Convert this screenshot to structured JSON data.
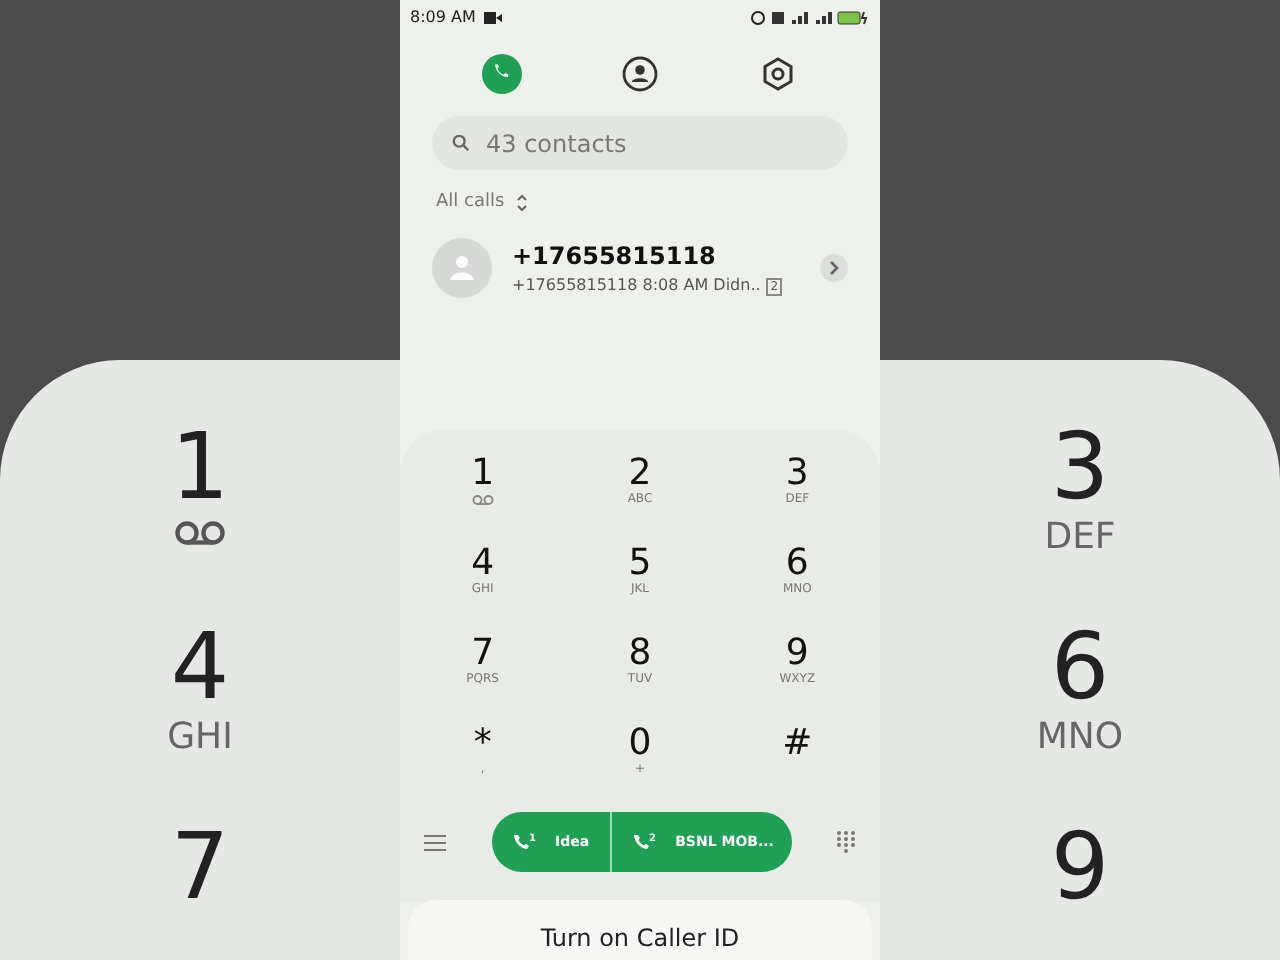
{
  "backdrop_left": [
    {
      "digit": "1",
      "kind": "voicemail"
    },
    {
      "digit": "4",
      "letters": "GHI"
    },
    {
      "digit": "7"
    }
  ],
  "backdrop_right": [
    {
      "digit": "3",
      "letters": "DEF"
    },
    {
      "digit": "6",
      "letters": "MNO"
    },
    {
      "digit": "9"
    }
  ],
  "status_bar": {
    "time": "8:09 AM"
  },
  "tabs": [
    {
      "kind": "phone",
      "selected": true
    },
    {
      "kind": "contacts",
      "selected": false
    },
    {
      "kind": "settings",
      "selected": false
    }
  ],
  "search": {
    "placeholder": "43 contacts"
  },
  "filter": {
    "label": "All calls"
  },
  "calls": [
    {
      "name": "+17655815118",
      "detail": "+17655815118  8:08 AM Didn..",
      "sim": "2"
    }
  ],
  "keys": [
    {
      "digit": "1",
      "kind": "voicemail"
    },
    {
      "digit": "2",
      "letters": "ABC"
    },
    {
      "digit": "3",
      "letters": "DEF"
    },
    {
      "digit": "4",
      "letters": "GHI"
    },
    {
      "digit": "5",
      "letters": "JKL"
    },
    {
      "digit": "6",
      "letters": "MNO"
    },
    {
      "digit": "7",
      "letters": "PQRS"
    },
    {
      "digit": "8",
      "letters": "TUV"
    },
    {
      "digit": "9",
      "letters": "WXYZ"
    },
    {
      "digit": "*",
      "letters": ","
    },
    {
      "digit": "0",
      "letters": "+"
    },
    {
      "digit": "#"
    }
  ],
  "sim_buttons": [
    {
      "label": "Idea",
      "sim": "1"
    },
    {
      "label": "BSNL MOB...",
      "sim": "2"
    }
  ],
  "sheet": {
    "title": "Turn on Caller ID"
  }
}
